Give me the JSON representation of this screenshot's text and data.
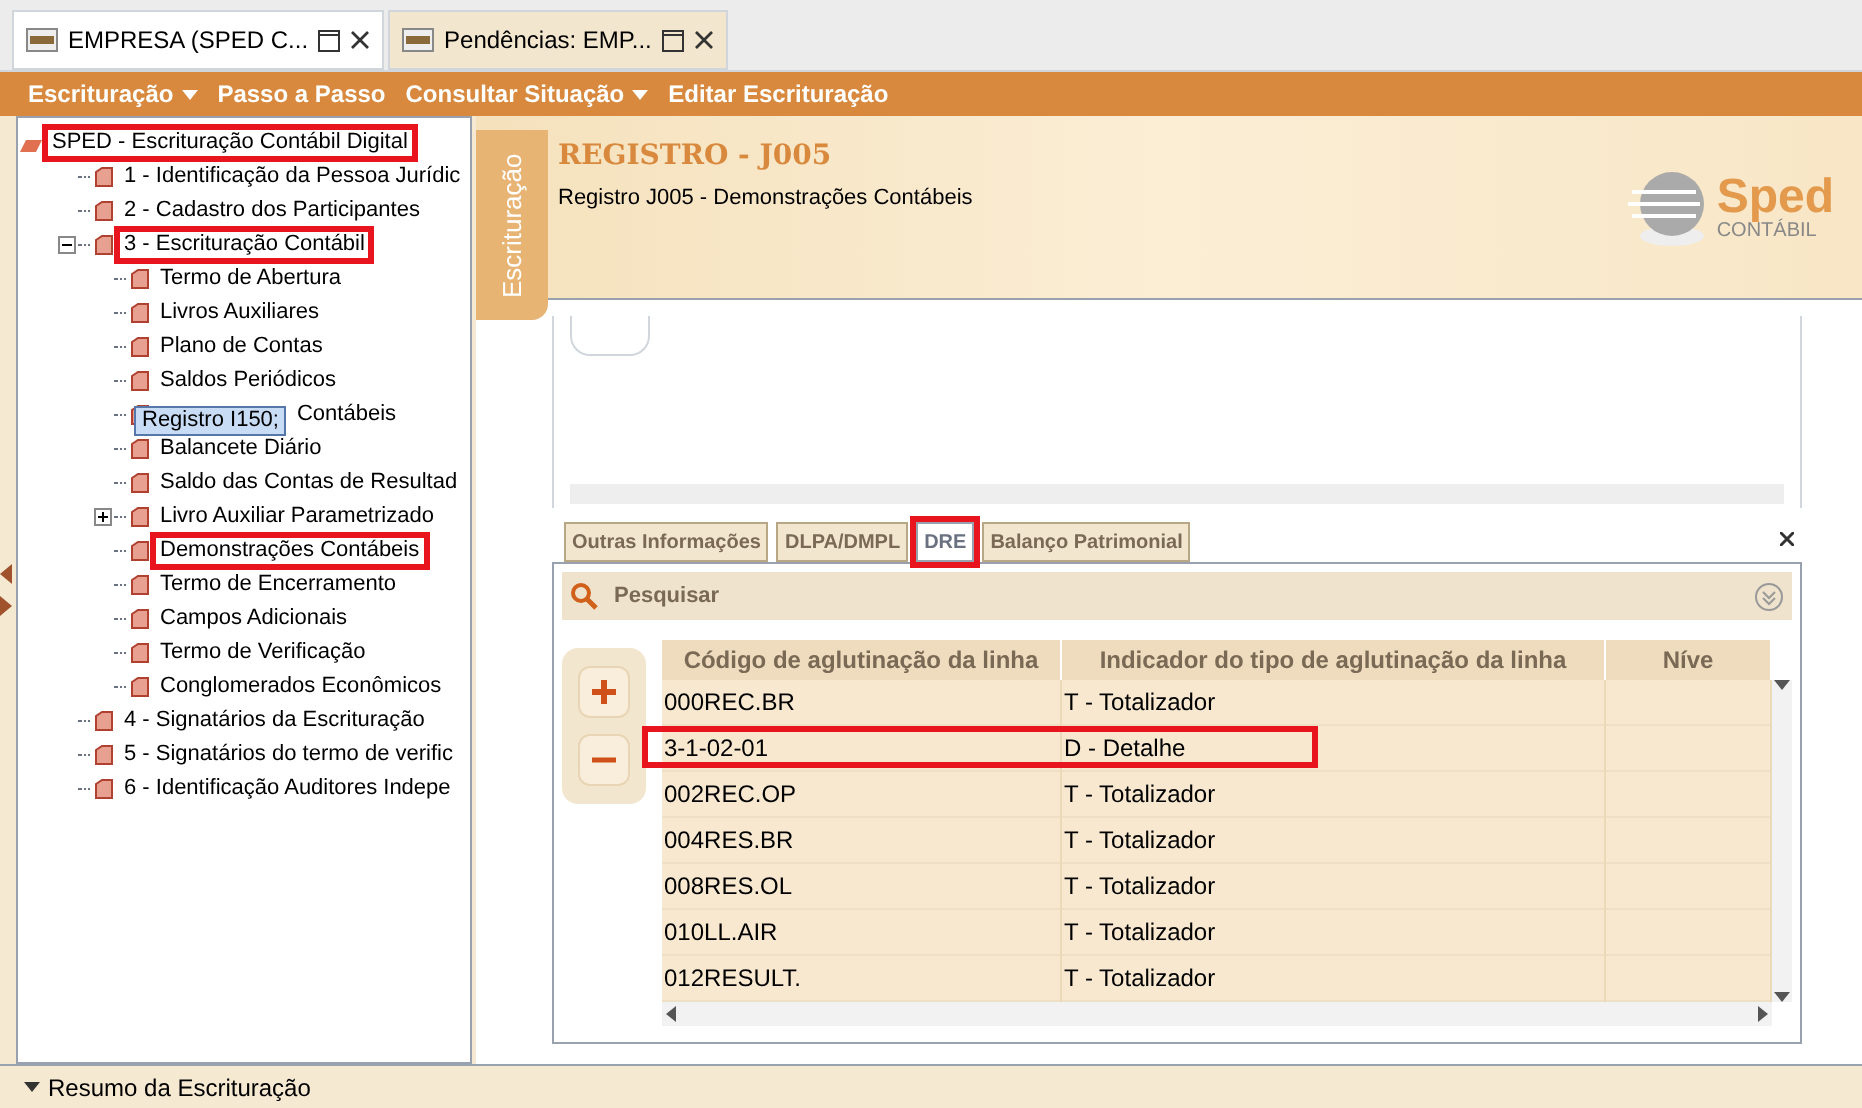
{
  "doc_tabs": [
    {
      "label": "EMPRESA (SPED C...",
      "selected": true
    },
    {
      "label": "Pendências: EMP...",
      "selected": false
    }
  ],
  "menu": [
    {
      "label": "Escrituração",
      "dropdown": true
    },
    {
      "label": "Passo a Passo",
      "dropdown": false
    },
    {
      "label": "Consultar Situação",
      "dropdown": true
    },
    {
      "label": "Editar Escrituração",
      "dropdown": false
    }
  ],
  "tree": [
    {
      "label": "SPED - Escrituração Contábil Digital",
      "highlighted": true,
      "expanded": true,
      "children": [
        {
          "label": "1 - Identificação da Pessoa Jurídic",
          "highlighted": false
        },
        {
          "label": "2 - Cadastro dos Participantes",
          "highlighted": false
        },
        {
          "label": "3 - Escrituração Contábil",
          "highlighted": true,
          "expanded": true,
          "children": [
            {
              "label": "Termo de Abertura",
              "highlighted": false
            },
            {
              "label": "Livros Auxiliares",
              "highlighted": false
            },
            {
              "label": "Plano de Contas",
              "highlighted": false
            },
            {
              "label": "Saldos Periódicos",
              "highlighted": false
            },
            {
              "label": "Contábeis",
              "highlighted": false,
              "tooltip": "Registro I150;"
            },
            {
              "label": "Balancete Diário",
              "highlighted": false
            },
            {
              "label": "Saldo das Contas de Resultad",
              "highlighted": false
            },
            {
              "label": "Livro Auxiliar Parametrizado",
              "highlighted": false,
              "expanded": false
            },
            {
              "label": "Demonstrações Contábeis",
              "highlighted": true
            },
            {
              "label": "Termo de Encerramento",
              "highlighted": false
            },
            {
              "label": "Campos Adicionais",
              "highlighted": false
            },
            {
              "label": "Termo de Verificação",
              "highlighted": false
            },
            {
              "label": "Conglomerados Econômicos",
              "highlighted": false
            }
          ]
        },
        {
          "label": "4 - Signatários da Escrituração",
          "highlighted": false
        },
        {
          "label": "5 - Signatários do termo de verific",
          "highlighted": false
        },
        {
          "label": "6 - Identificação Auditores Indepe",
          "highlighted": false
        }
      ]
    }
  ],
  "side_tab": "Escrituração",
  "header": {
    "title": "REGISTRO - J005",
    "subtitle": "Registro J005 - Demonstrações Contábeis",
    "logo_name": "Sped",
    "logo_sub": "CONTÁBIL"
  },
  "sub_tabs": [
    {
      "label": "Outras Informações",
      "selected": false,
      "highlighted": false
    },
    {
      "label": "DLPA/DMPL",
      "selected": false,
      "highlighted": false
    },
    {
      "label": "DRE",
      "selected": true,
      "highlighted": true
    },
    {
      "label": "Balanço Patrimonial",
      "selected": false,
      "highlighted": false
    }
  ],
  "search_bar": {
    "label": "Pesquisar"
  },
  "table": {
    "columns": [
      "Código de aglutinação da linha",
      "Indicador do tipo de aglutinação da linha",
      "Níve"
    ],
    "rows": [
      {
        "cells": [
          "000REC.BR",
          "T - Totalizador"
        ],
        "highlighted": false
      },
      {
        "cells": [
          "3-1-02-01",
          "D - Detalhe"
        ],
        "highlighted": true
      },
      {
        "cells": [
          "002REC.OP",
          "T - Totalizador"
        ],
        "highlighted": false
      },
      {
        "cells": [
          "004RES.BR",
          "T - Totalizador"
        ],
        "highlighted": false
      },
      {
        "cells": [
          "008RES.OL",
          "T - Totalizador"
        ],
        "highlighted": false
      },
      {
        "cells": [
          "010LL.AIR",
          "T - Totalizador"
        ],
        "highlighted": false
      },
      {
        "cells": [
          "012RESULT.",
          "T - Totalizador"
        ],
        "highlighted": false
      }
    ]
  },
  "status_bar": {
    "label": "Resumo da Escrituração"
  }
}
